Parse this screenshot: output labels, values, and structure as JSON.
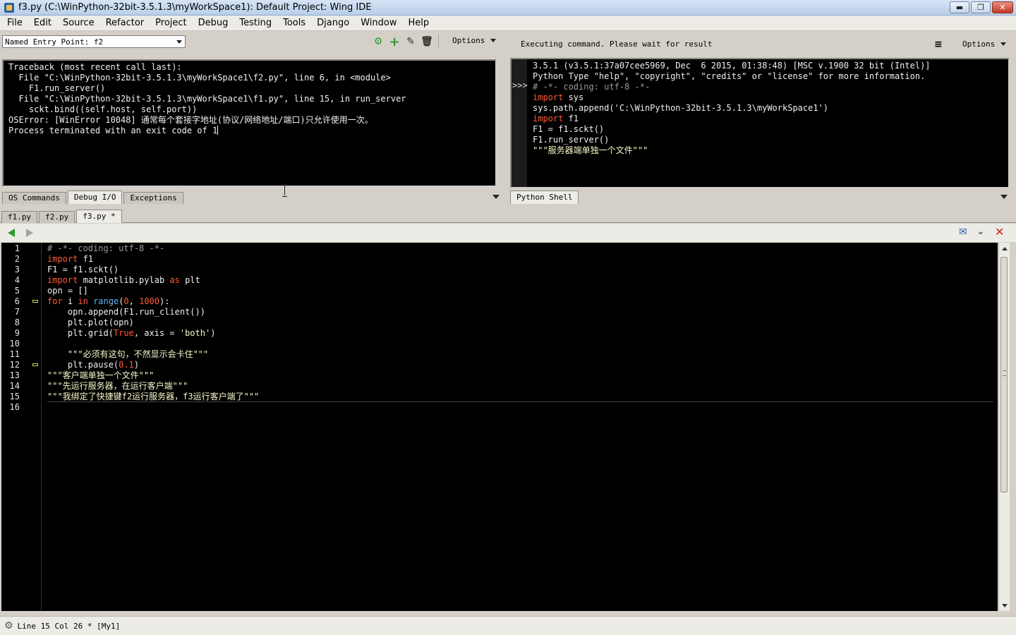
{
  "window": {
    "title": "f3.py (C:\\WinPython-32bit-3.5.1.3\\myWorkSpace1): Default Project: Wing IDE",
    "buttons": [
      "minimize",
      "maximize",
      "close"
    ]
  },
  "menu": [
    "File",
    "Edit",
    "Source",
    "Refactor",
    "Project",
    "Debug",
    "Testing",
    "Tools",
    "Django",
    "Window",
    "Help"
  ],
  "debug_io": {
    "entry_point_label": "Named Entry Point: f2",
    "options_label": "Options",
    "tool_icons": [
      "gear-run-icon",
      "add-icon",
      "pencil-icon",
      "trash-icon"
    ],
    "output_lines": [
      "Traceback (most recent call last):",
      "  File \"C:\\WinPython-32bit-3.5.1.3\\myWorkSpace1\\f2.py\", line 6, in <module>",
      "    F1.run_server()",
      "  File \"C:\\WinPython-32bit-3.5.1.3\\myWorkSpace1\\f1.py\", line 15, in run_server",
      "    sckt.bind((self.host, self.port))",
      "OSError: [WinError 10048] 通常每个套接字地址(协议/网络地址/端口)只允许使用一次。",
      "Process terminated with an exit code of 1"
    ],
    "tabs": [
      "OS Commands",
      "Debug I/O",
      "Exceptions"
    ],
    "active_tab": "Debug I/O"
  },
  "python_shell": {
    "status": "Executing command.  Please wait for result",
    "options_label": "Options",
    "prompt": ">>>",
    "lines": [
      {
        "text": "3.5.1 (v3.5.1:37a07cee5969, Dec  6 2015, 01:38:48) [MSC v.1900 32 bit (Intel)]",
        "kind": "t"
      },
      {
        "text": "Python Type \"help\", \"copyright\", \"credits\" or \"license\" for more information.",
        "kind": "t"
      },
      {
        "text": "# -*- coding: utf-8 -*-",
        "kind": "cm"
      },
      {
        "kw": "import",
        "rest": " sys"
      },
      {
        "text": "sys.path.append('C:\\WinPython-32bit-3.5.1.3\\myWorkSpace1')",
        "kind": "t"
      },
      {
        "kw": "import",
        "rest": " f1"
      },
      {
        "text": "F1 = f1.sckt()",
        "kind": "t"
      },
      {
        "text": "F1.run_server()",
        "kind": "t"
      },
      {
        "text": "\"\"\"服务器端单独一个文件\"\"\"",
        "kind": "st"
      }
    ],
    "tab": "Python Shell"
  },
  "editor": {
    "file_tabs": [
      "f1.py",
      "f2.py",
      "f3.py *"
    ],
    "active_file": "f3.py *",
    "lines": [
      [
        {
          "c": "cm",
          "t": "# -*- coding: utf-8 -*-"
        }
      ],
      [
        {
          "c": "kw",
          "t": "import"
        },
        {
          "c": "t",
          "t": " f1"
        }
      ],
      [
        {
          "c": "t",
          "t": "F1 = f1.sckt()"
        }
      ],
      [
        {
          "c": "kw",
          "t": "import"
        },
        {
          "c": "t",
          "t": " matplotlib.pylab "
        },
        {
          "c": "kw",
          "t": "as"
        },
        {
          "c": "t",
          "t": " plt"
        }
      ],
      [
        {
          "c": "t",
          "t": "opn = []"
        }
      ],
      [
        {
          "c": "kw",
          "t": "for"
        },
        {
          "c": "t",
          "t": " i "
        },
        {
          "c": "kw",
          "t": "in"
        },
        {
          "c": "t",
          "t": " "
        },
        {
          "c": "bi",
          "t": "range"
        },
        {
          "c": "t",
          "t": "("
        },
        {
          "c": "nm",
          "t": "0"
        },
        {
          "c": "t",
          "t": ", "
        },
        {
          "c": "nm",
          "t": "1000"
        },
        {
          "c": "t",
          "t": "):"
        }
      ],
      [
        {
          "c": "t",
          "t": "    opn.append(F1.run_client())"
        }
      ],
      [
        {
          "c": "t",
          "t": "    plt.plot(opn)"
        }
      ],
      [
        {
          "c": "t",
          "t": "    plt.grid("
        },
        {
          "c": "kw",
          "t": "True"
        },
        {
          "c": "t",
          "t": ", axis = "
        },
        {
          "c": "st",
          "t": "'both'"
        },
        {
          "c": "t",
          "t": ")"
        }
      ],
      [],
      [
        {
          "c": "st",
          "t": "    \"\"\"必须有这句，不然显示会卡住\"\"\""
        }
      ],
      [
        {
          "c": "t",
          "t": "    plt.pause("
        },
        {
          "c": "nm",
          "t": "0.1"
        },
        {
          "c": "t",
          "t": ")"
        }
      ],
      [
        {
          "c": "st",
          "t": "\"\"\"客户端单独一个文件\"\"\""
        }
      ],
      [
        {
          "c": "st",
          "t": "\"\"\"先运行服务器，在运行客户端\"\"\""
        }
      ],
      [
        {
          "c": "st",
          "t": "\"\"\"我绑定了快捷键f2运行服务器，f3运行客户端了\"\"\""
        }
      ],
      []
    ],
    "fold_markers": [
      6,
      12
    ],
    "current_line": 15
  },
  "status": {
    "text": "Line 15 Col 26 * [My1]"
  }
}
